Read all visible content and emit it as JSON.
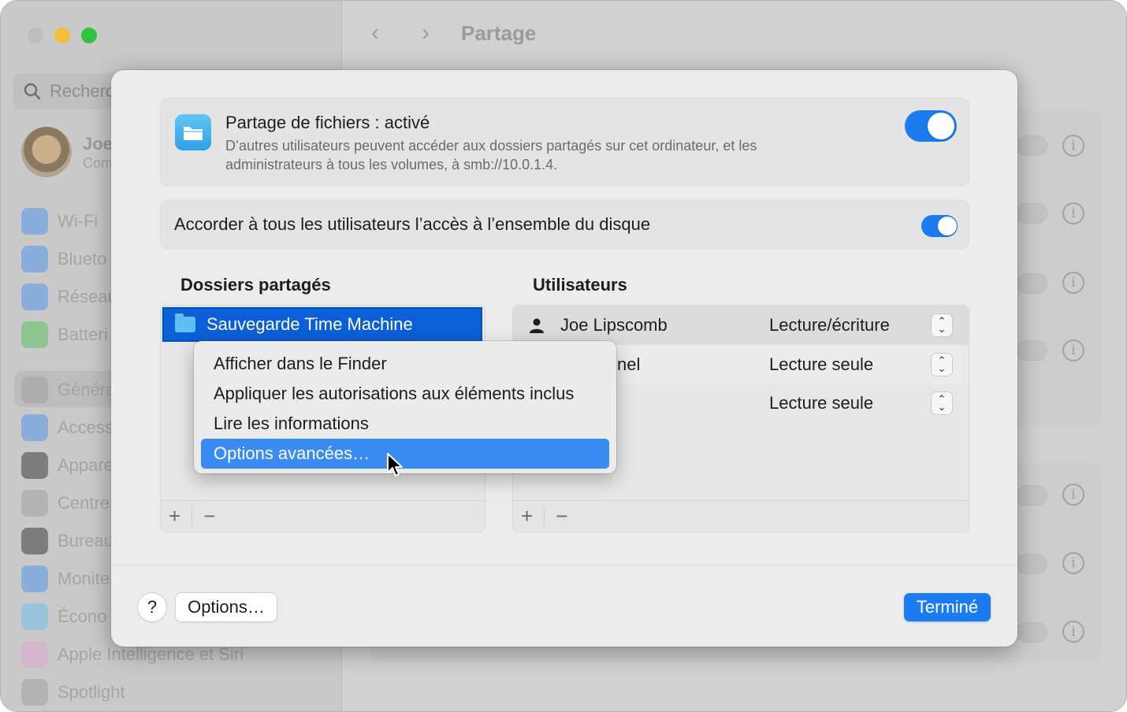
{
  "window": {
    "title": "Partage",
    "search_placeholder": "Recherc",
    "profile": {
      "name": "Joe",
      "subtitle": "Com"
    },
    "sidebar": [
      {
        "label": "Wi-Fi",
        "icon": "wifi-icon",
        "color": "#3d8ff4"
      },
      {
        "label": "Blueto",
        "icon": "bluetooth-icon",
        "color": "#3d8ff4"
      },
      {
        "label": "Réseau",
        "icon": "globe-icon",
        "color": "#3d8ff4"
      },
      {
        "label": "Batteri",
        "icon": "battery-icon",
        "color": "#46c24c"
      },
      {
        "label": "Généra",
        "icon": "gear-icon",
        "color": "#9a9a9a"
      },
      {
        "label": "Access",
        "icon": "accessibility-icon",
        "color": "#3d8ff4"
      },
      {
        "label": "Appare",
        "icon": "appearance-icon",
        "color": "#222222"
      },
      {
        "label": "Centre",
        "icon": "control-center-icon",
        "color": "#9a9a9a"
      },
      {
        "label": "Bureau",
        "icon": "desktop-icon",
        "color": "#222222"
      },
      {
        "label": "Monite",
        "icon": "display-icon",
        "color": "#3d8ff4"
      },
      {
        "label": "Écono",
        "icon": "screensaver-icon",
        "color": "#5fbff2"
      },
      {
        "label": "Apple Intelligence et Siri",
        "icon": "siri-icon",
        "color": "#e0a0d0"
      },
      {
        "label": "Spotlight",
        "icon": "spotlight-icon",
        "color": "#9a9a9a"
      }
    ]
  },
  "sheet": {
    "file_sharing": {
      "title": "Partage de fichiers : activé",
      "description": "D’autres utilisateurs peuvent accéder aux dossiers partagés sur cet ordinateur, et les administrateurs à tous les volumes, à smb://10.0.1.4.",
      "enabled": true
    },
    "full_disk": {
      "label": "Accorder à tous les utilisateurs l’accès à l’ensemble du disque",
      "enabled": true
    },
    "folders_header": "Dossiers partagés",
    "users_header": "Utilisateurs",
    "folders": [
      {
        "name": "Sauvegarde Time Machine",
        "selected": true
      }
    ],
    "users": [
      {
        "name": "Joe Lipscomb",
        "permission": "Lecture/écriture"
      },
      {
        "name": "nel",
        "permission": "Lecture seule"
      },
      {
        "name": "",
        "permission": "Lecture seule"
      }
    ],
    "context_menu": [
      {
        "label": "Afficher dans le Finder",
        "active": false
      },
      {
        "label": "Appliquer les autorisations aux éléments inclus",
        "active": false
      },
      {
        "label": "Lire les informations",
        "active": false
      },
      {
        "label": "Options avancées…",
        "active": true
      }
    ],
    "add_label": "+",
    "remove_label": "−",
    "help_label": "?",
    "options_label": "Options…",
    "done_label": "Terminé"
  }
}
